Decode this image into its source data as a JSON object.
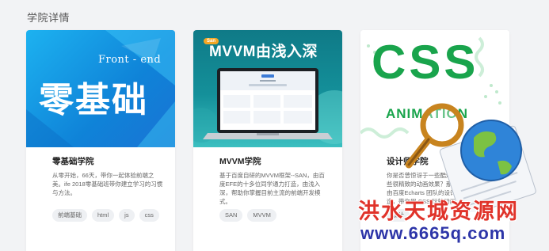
{
  "section": {
    "title": "学院详情"
  },
  "cards": [
    {
      "title": "零基础学院",
      "description": "从零开始，66天，带你一起体验前端之美。ife 2018零基础班带你建立学习的习惯与方法。",
      "tags": [
        "前端基础",
        "html",
        "js",
        "css"
      ],
      "thumb": {
        "heading": "Front - end",
        "big_text": "零基础"
      }
    },
    {
      "title": "MVVM学院",
      "description": "基于百度自研的MVVM框架--SAN，由百度EFE的十多位同学通力打造，由浅入深，帮助你掌握目前主流的前端开发模式。",
      "tags": [
        "SAN",
        "MVVM"
      ],
      "thumb": {
        "badge": "San",
        "heading": "MVVM由浅入深"
      }
    },
    {
      "title": "设计师学院",
      "description": "你是否曾惊讶于一些酷炫的网页特效，一些很精致的动画效果？那么这个课程就是由百度Echarts 团队的设计师为你量身打造，带你用 CSS 玩转动画",
      "tags": [
        "设计"
      ],
      "thumb": {
        "big_text": "CSS",
        "sub_text": "ANIMATION"
      }
    }
  ],
  "watermark": {
    "text": "洪水天城资源网",
    "url": "www.6665q.com"
  },
  "colors": {
    "page_bg": "#f2f3f5",
    "accent_green": "#19a44c",
    "front_end_blue": "#1296e4",
    "mvvm_teal": "#14909a",
    "watermark_red": "#e0332a",
    "watermark_blue": "#2d35a8"
  }
}
